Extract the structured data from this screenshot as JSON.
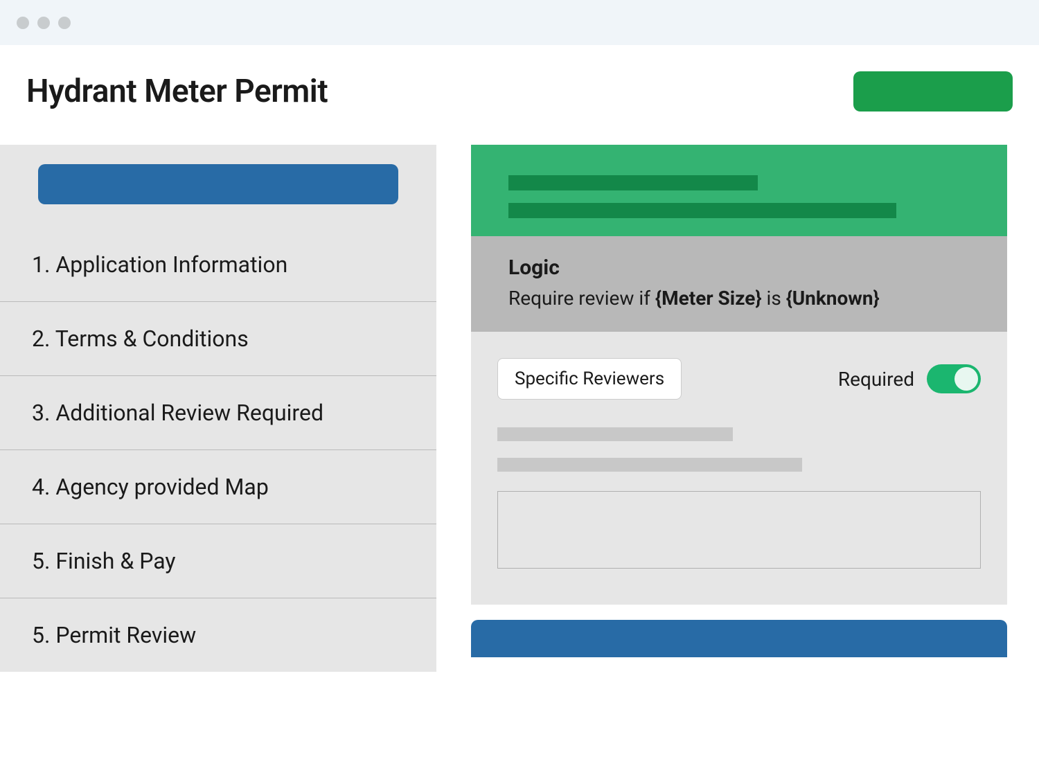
{
  "header": {
    "title": "Hydrant Meter Permit"
  },
  "sidebar": {
    "items": [
      {
        "label": "1. Application Information"
      },
      {
        "label": "2. Terms & Conditions"
      },
      {
        "label": "3. Additional Review Required"
      },
      {
        "label": "4. Agency provided Map"
      },
      {
        "label": "5. Finish & Pay"
      },
      {
        "label": "5. Permit Review"
      }
    ]
  },
  "logic": {
    "title": "Logic",
    "prefix": "Require review if ",
    "token1": "{Meter Size}",
    "connector": " is ",
    "token2": "{Unknown}"
  },
  "reviewers": {
    "button_label": "Specific Reviewers",
    "required_label": "Required",
    "toggle_on": true
  },
  "colors": {
    "green_primary": "#1b9e4b",
    "green_panel": "#34b372",
    "green_dark": "#138849",
    "blue": "#286ba6",
    "toggle_green": "#1bb66f",
    "gray_panel": "#e6e6e6",
    "gray_logic": "#b8b8b8"
  }
}
